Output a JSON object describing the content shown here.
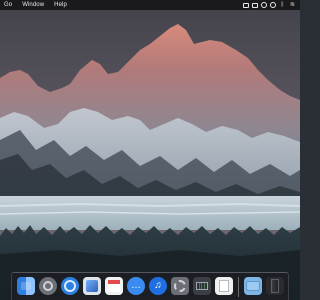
{
  "menubar": {
    "items": [
      "Go",
      "Window",
      "Help"
    ],
    "status_icons": [
      "screen-mirroring-icon",
      "display-icon",
      "time-machine-icon",
      "sync-icon",
      "bluetooth-icon",
      "wifi-icon"
    ]
  },
  "dock": {
    "items": [
      {
        "name": "finder",
        "color": "#3d8ee8"
      },
      {
        "name": "launchpad",
        "color": "#7b7f86"
      },
      {
        "name": "safari",
        "color": "#2f7fe0"
      },
      {
        "name": "preview",
        "color": "#dfe4ea"
      },
      {
        "name": "calendar",
        "color": "#f3f3f3"
      },
      {
        "name": "messages",
        "color": "#3a8bf0"
      },
      {
        "name": "music",
        "color": "#1f6fe0"
      },
      {
        "name": "system-preferences",
        "color": "#6c6f75"
      },
      {
        "name": "activity-monitor",
        "color": "#3b3f45"
      },
      {
        "name": "textedit",
        "color": "#f0f0f0"
      },
      {
        "name": "folder",
        "color": "#7fb6e6"
      },
      {
        "name": "trash",
        "color": "#2b2b2f"
      }
    ]
  }
}
